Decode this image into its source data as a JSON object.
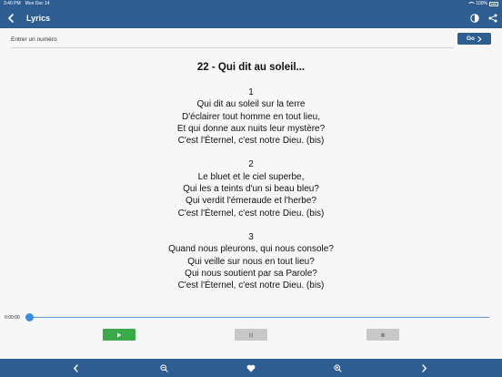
{
  "status_bar": {
    "time": "3:40 PM",
    "date": "Mon Dec 14",
    "battery": "100%"
  },
  "nav": {
    "title": "Lyrics"
  },
  "search": {
    "placeholder": "Entrer un numéro",
    "value": "",
    "go_label": "Go"
  },
  "song": {
    "title": "22 - Qui dit au soleil...",
    "verses": [
      {
        "number": "1",
        "lines": [
          "Qui dit au soleil sur la terre",
          "D'éclairer tout homme en tout lieu,",
          "Et qui donne aux nuits leur mystère?",
          "C'est l'Éternel, c'est notre Dieu. (bis)"
        ]
      },
      {
        "number": "2",
        "lines": [
          "Le bluet et le ciel superbe,",
          "Qui les a teints d'un si beau bleu?",
          "Qui verdit l'émeraude et l'herbe?",
          "C'est l'Éternel, c'est notre Dieu. (bis)"
        ]
      },
      {
        "number": "3",
        "lines": [
          "Quand nous pleurons, qui nous console?",
          "Qui veille sur nous en tout lieu?",
          "Qui nous soutient par sa Parole?",
          "C'est l'Éternel, c'est notre Dieu. (bis)"
        ]
      }
    ]
  },
  "player": {
    "elapsed": "0:00:00",
    "progress": 0
  },
  "colors": {
    "brand": "#2e5e91",
    "play": "#3aaa4b",
    "disabled": "#c8c8c8",
    "slider": "#3a8ee0"
  },
  "icons": {
    "nav": [
      "back-icon",
      "contrast-icon",
      "share-icon"
    ],
    "tabbar": [
      "chevron-left-icon",
      "zoom-out-icon",
      "heart-icon",
      "zoom-in-icon",
      "chevron-right-icon"
    ]
  }
}
